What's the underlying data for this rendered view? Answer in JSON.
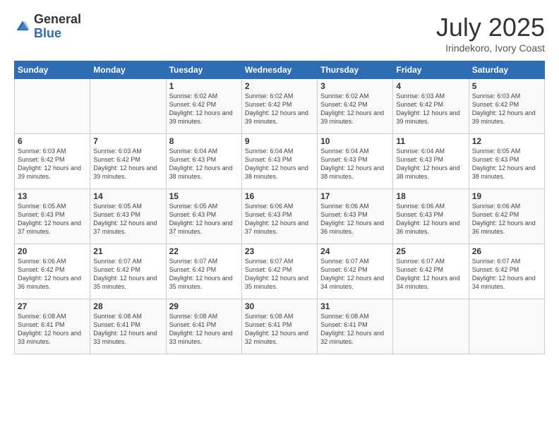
{
  "header": {
    "logo_general": "General",
    "logo_blue": "Blue",
    "month": "July 2025",
    "location": "Irindekoro, Ivory Coast"
  },
  "days_of_week": [
    "Sunday",
    "Monday",
    "Tuesday",
    "Wednesday",
    "Thursday",
    "Friday",
    "Saturday"
  ],
  "weeks": [
    [
      {
        "day": "",
        "info": ""
      },
      {
        "day": "",
        "info": ""
      },
      {
        "day": "1",
        "info": "Sunrise: 6:02 AM\nSunset: 6:42 PM\nDaylight: 12 hours and 39 minutes."
      },
      {
        "day": "2",
        "info": "Sunrise: 6:02 AM\nSunset: 6:42 PM\nDaylight: 12 hours and 39 minutes."
      },
      {
        "day": "3",
        "info": "Sunrise: 6:02 AM\nSunset: 6:42 PM\nDaylight: 12 hours and 39 minutes."
      },
      {
        "day": "4",
        "info": "Sunrise: 6:03 AM\nSunset: 6:42 PM\nDaylight: 12 hours and 39 minutes."
      },
      {
        "day": "5",
        "info": "Sunrise: 6:03 AM\nSunset: 6:42 PM\nDaylight: 12 hours and 39 minutes."
      }
    ],
    [
      {
        "day": "6",
        "info": "Sunrise: 6:03 AM\nSunset: 6:42 PM\nDaylight: 12 hours and 39 minutes."
      },
      {
        "day": "7",
        "info": "Sunrise: 6:03 AM\nSunset: 6:42 PM\nDaylight: 12 hours and 39 minutes."
      },
      {
        "day": "8",
        "info": "Sunrise: 6:04 AM\nSunset: 6:43 PM\nDaylight: 12 hours and 38 minutes."
      },
      {
        "day": "9",
        "info": "Sunrise: 6:04 AM\nSunset: 6:43 PM\nDaylight: 12 hours and 38 minutes."
      },
      {
        "day": "10",
        "info": "Sunrise: 6:04 AM\nSunset: 6:43 PM\nDaylight: 12 hours and 38 minutes."
      },
      {
        "day": "11",
        "info": "Sunrise: 6:04 AM\nSunset: 6:43 PM\nDaylight: 12 hours and 38 minutes."
      },
      {
        "day": "12",
        "info": "Sunrise: 6:05 AM\nSunset: 6:43 PM\nDaylight: 12 hours and 38 minutes."
      }
    ],
    [
      {
        "day": "13",
        "info": "Sunrise: 6:05 AM\nSunset: 6:43 PM\nDaylight: 12 hours and 37 minutes."
      },
      {
        "day": "14",
        "info": "Sunrise: 6:05 AM\nSunset: 6:43 PM\nDaylight: 12 hours and 37 minutes."
      },
      {
        "day": "15",
        "info": "Sunrise: 6:05 AM\nSunset: 6:43 PM\nDaylight: 12 hours and 37 minutes."
      },
      {
        "day": "16",
        "info": "Sunrise: 6:06 AM\nSunset: 6:43 PM\nDaylight: 12 hours and 37 minutes."
      },
      {
        "day": "17",
        "info": "Sunrise: 6:06 AM\nSunset: 6:43 PM\nDaylight: 12 hours and 36 minutes."
      },
      {
        "day": "18",
        "info": "Sunrise: 6:06 AM\nSunset: 6:43 PM\nDaylight: 12 hours and 36 minutes."
      },
      {
        "day": "19",
        "info": "Sunrise: 6:06 AM\nSunset: 6:42 PM\nDaylight: 12 hours and 36 minutes."
      }
    ],
    [
      {
        "day": "20",
        "info": "Sunrise: 6:06 AM\nSunset: 6:42 PM\nDaylight: 12 hours and 36 minutes."
      },
      {
        "day": "21",
        "info": "Sunrise: 6:07 AM\nSunset: 6:42 PM\nDaylight: 12 hours and 35 minutes."
      },
      {
        "day": "22",
        "info": "Sunrise: 6:07 AM\nSunset: 6:42 PM\nDaylight: 12 hours and 35 minutes."
      },
      {
        "day": "23",
        "info": "Sunrise: 6:07 AM\nSunset: 6:42 PM\nDaylight: 12 hours and 35 minutes."
      },
      {
        "day": "24",
        "info": "Sunrise: 6:07 AM\nSunset: 6:42 PM\nDaylight: 12 hours and 34 minutes."
      },
      {
        "day": "25",
        "info": "Sunrise: 6:07 AM\nSunset: 6:42 PM\nDaylight: 12 hours and 34 minutes."
      },
      {
        "day": "26",
        "info": "Sunrise: 6:07 AM\nSunset: 6:42 PM\nDaylight: 12 hours and 34 minutes."
      }
    ],
    [
      {
        "day": "27",
        "info": "Sunrise: 6:08 AM\nSunset: 6:41 PM\nDaylight: 12 hours and 33 minutes."
      },
      {
        "day": "28",
        "info": "Sunrise: 6:08 AM\nSunset: 6:41 PM\nDaylight: 12 hours and 33 minutes."
      },
      {
        "day": "29",
        "info": "Sunrise: 6:08 AM\nSunset: 6:41 PM\nDaylight: 12 hours and 33 minutes."
      },
      {
        "day": "30",
        "info": "Sunrise: 6:08 AM\nSunset: 6:41 PM\nDaylight: 12 hours and 32 minutes."
      },
      {
        "day": "31",
        "info": "Sunrise: 6:08 AM\nSunset: 6:41 PM\nDaylight: 12 hours and 32 minutes."
      },
      {
        "day": "",
        "info": ""
      },
      {
        "day": "",
        "info": ""
      }
    ]
  ]
}
